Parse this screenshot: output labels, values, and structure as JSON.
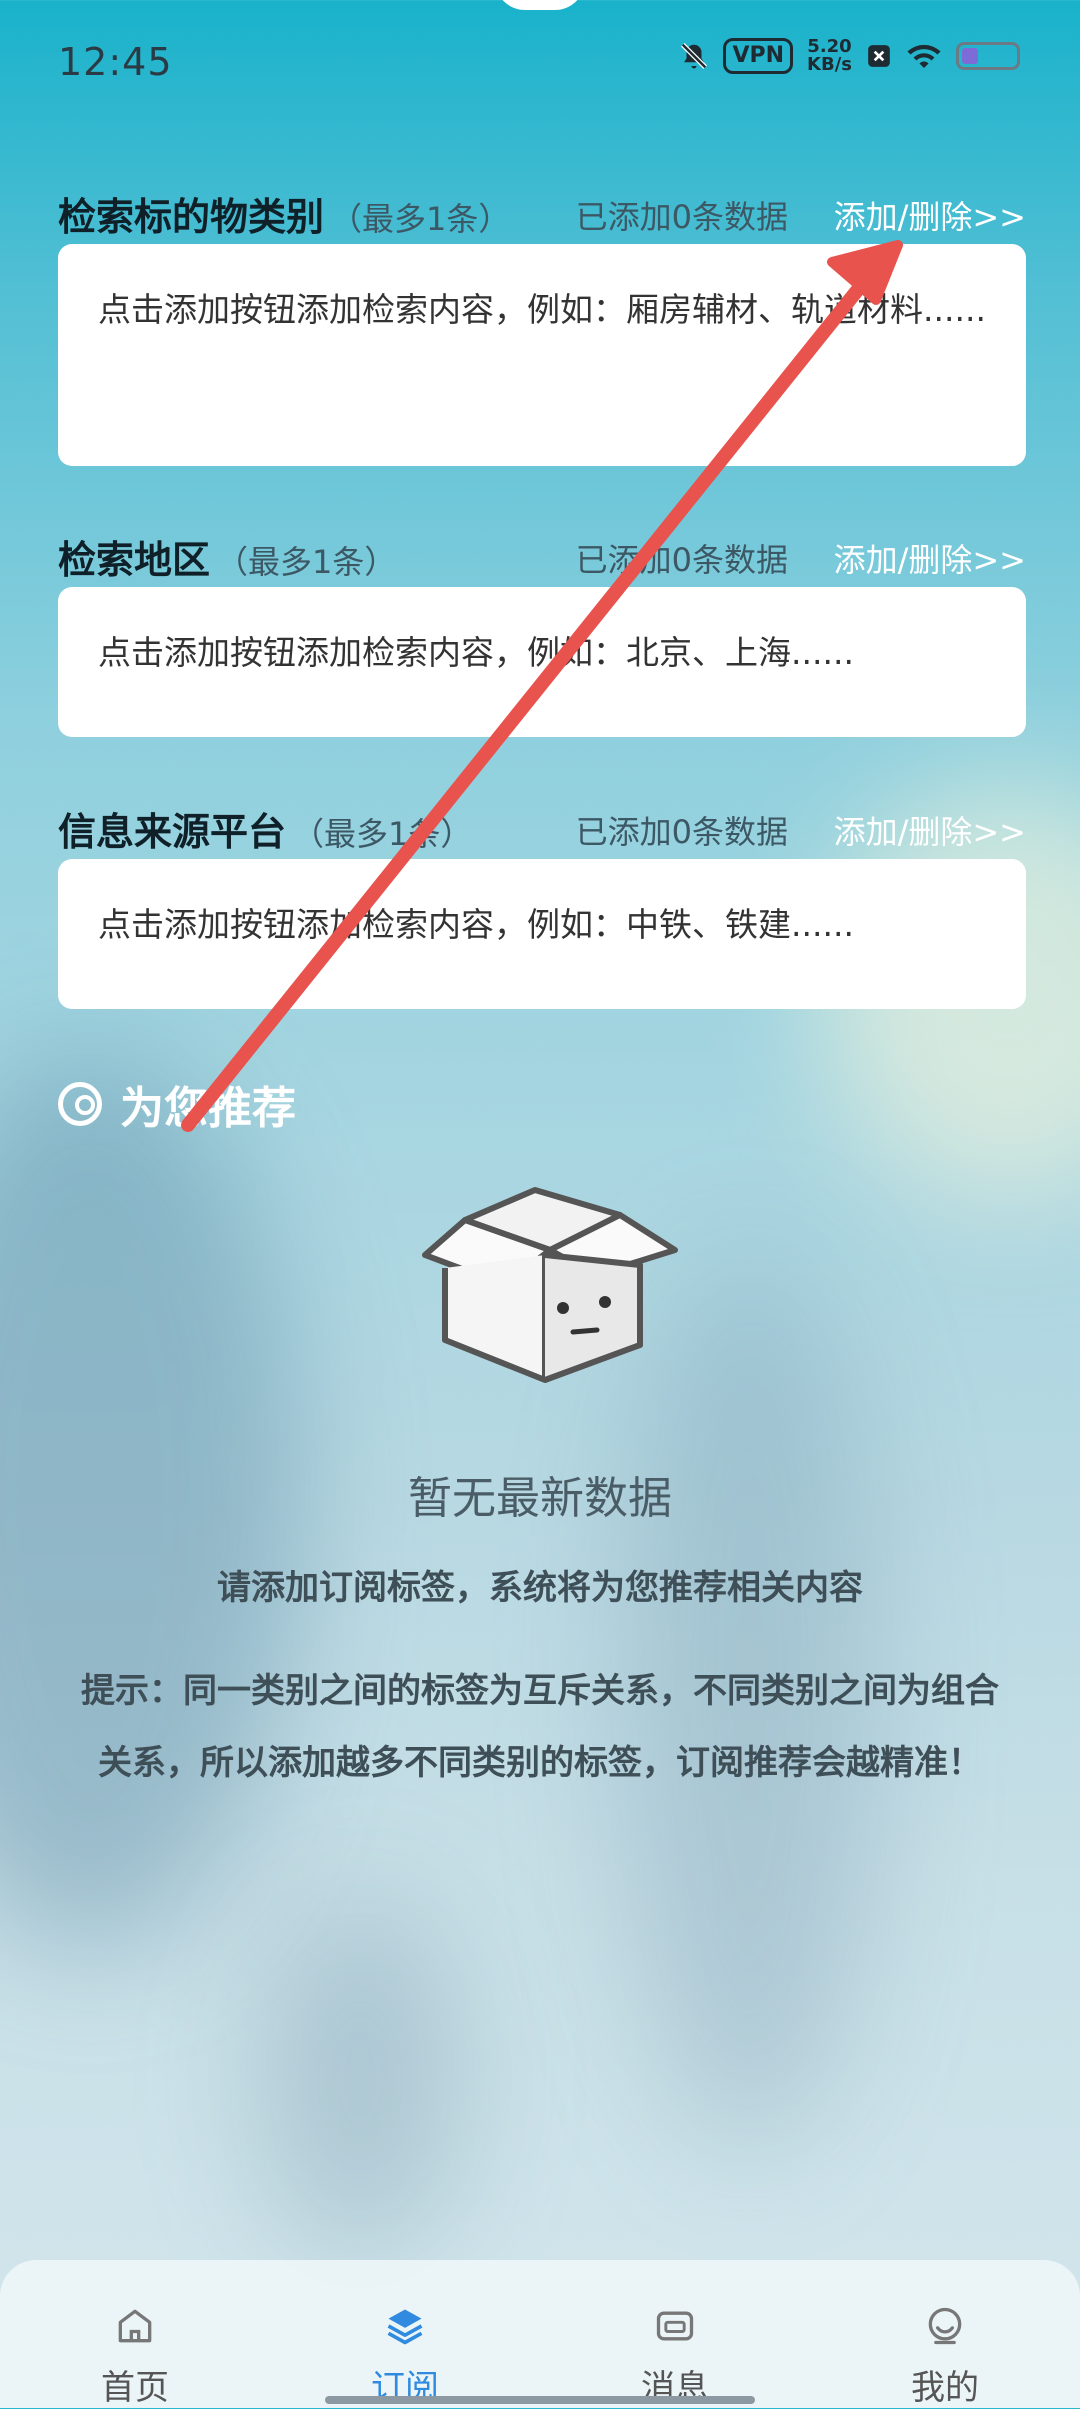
{
  "status": {
    "time": "12:45",
    "vpn": "VPN",
    "speed_top": "5.20",
    "speed_bottom": "KB/s",
    "battery_level": 0.28
  },
  "sections": [
    {
      "title": "检索标的物类别",
      "limit": "（最多1条）",
      "count": "已添加0条数据",
      "action": "添加/删除>>",
      "placeholder": "点击添加按钮添加检索内容，例如：厢房辅材、轨道材料......"
    },
    {
      "title": "检索地区",
      "limit": "（最多1条）",
      "count": "已添加0条数据",
      "action": "添加/删除>>",
      "placeholder": "点击添加按钮添加检索内容，例如：北京、上海......"
    },
    {
      "title": "信息来源平台",
      "limit": "（最多1条）",
      "count": "已添加0条数据",
      "action": "添加/删除>>",
      "placeholder": "点击添加按钮添加检索内容，例如：中铁、铁建......"
    }
  ],
  "recommend": {
    "title": "为您推荐",
    "empty_title": "暂无最新数据",
    "empty_sub": "请添加订阅标签，系统将为您推荐相关内容",
    "tip": "提示：同一类别之间的标签为互斥关系，不同类别之间为组合关系，所以添加越多不同类别的标签，订阅推荐会越精准！"
  },
  "tabs": [
    {
      "label": "首页",
      "icon": "home-icon",
      "active": false
    },
    {
      "label": "订阅",
      "icon": "layers-icon",
      "active": true
    },
    {
      "label": "消息",
      "icon": "message-icon",
      "active": false
    },
    {
      "label": "我的",
      "icon": "profile-icon",
      "active": false
    }
  ],
  "colors": {
    "accent": "#2f8ae0",
    "arrow": "#e8534e",
    "link": "#ffffff"
  }
}
